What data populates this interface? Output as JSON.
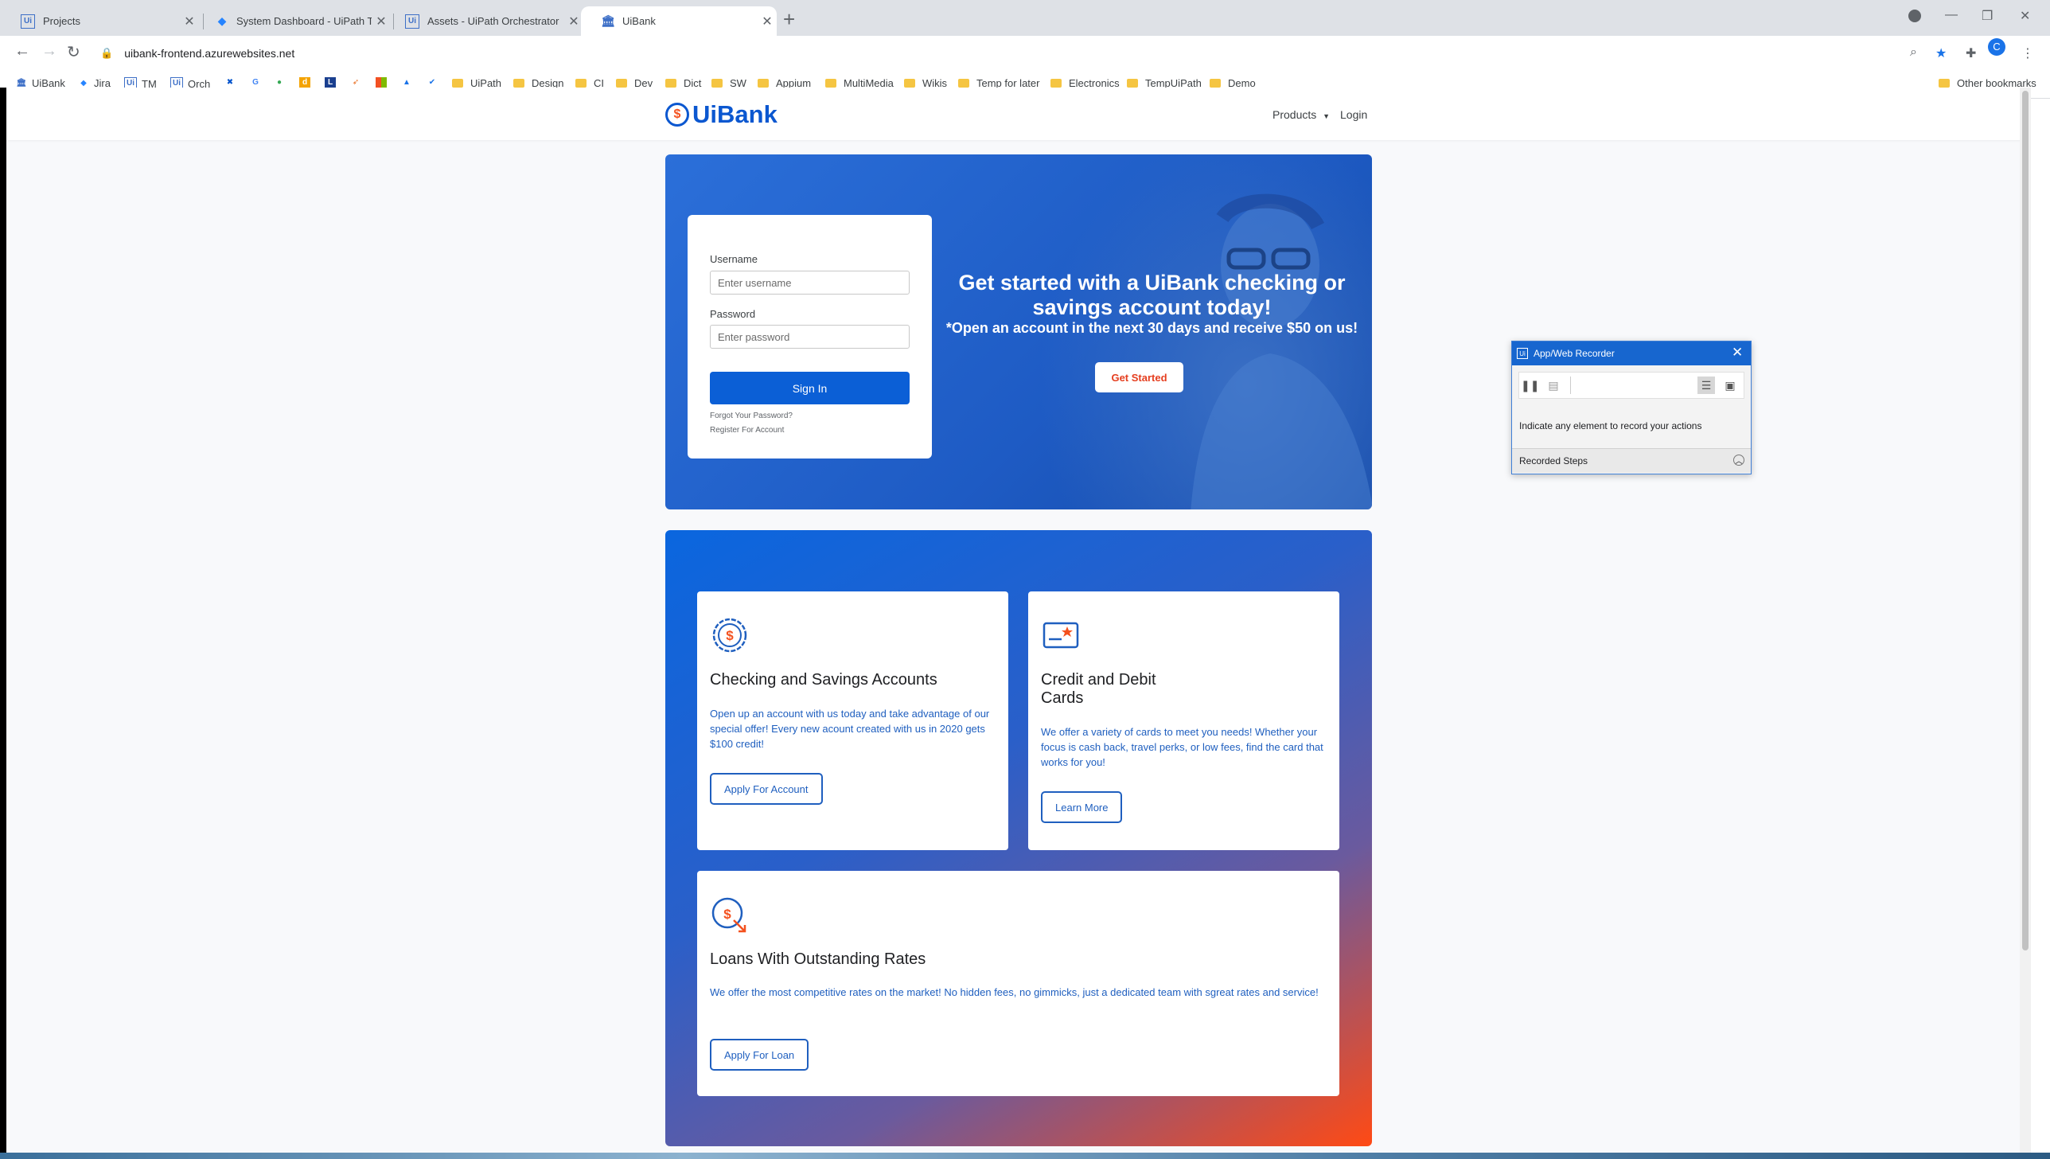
{
  "browser": {
    "tabs": [
      {
        "title": "Projects",
        "favicon": "uipath-icon"
      },
      {
        "title": "System Dashboard - UiPath Test:",
        "favicon": "jira-icon"
      },
      {
        "title": "Assets - UiPath Orchestrator",
        "favicon": "uipath-icon"
      },
      {
        "title": "UiBank",
        "favicon": "bank-icon",
        "active": true
      }
    ],
    "url": "uibank-frontend.azurewebsites.net",
    "profile_initial": "C",
    "bookmarks": [
      "UiBank",
      "Jira",
      "TM",
      "Orch",
      "UiPath",
      "Design",
      "CI",
      "Dev",
      "Dict",
      "SW",
      "Appium",
      "MultiMedia",
      "Wikis",
      "Temp for later",
      "Electronics",
      "TempUiPath",
      "Demo"
    ],
    "other_bookmarks": "Other bookmarks"
  },
  "site": {
    "logo_text": "UiBank",
    "logo_symbol": "$",
    "nav": {
      "products": "Products",
      "login": "Login"
    }
  },
  "login_form": {
    "username_label": "Username",
    "username_placeholder": "Enter username",
    "password_label": "Password",
    "password_placeholder": "Enter password",
    "signin_label": "Sign In",
    "forgot_password": "Forgot Your Password?",
    "register": "Register For Account"
  },
  "hero": {
    "title": "Get started with a UiBank checking or savings account today!",
    "subtitle": "*Open an account in the next 30 days and receive $50 on us!",
    "cta": "Get Started"
  },
  "features": [
    {
      "title": "Checking and Savings Accounts",
      "text": "Open up an account with us today and take advantage of our special offer! Every new acount created with us in 2020 gets $100 credit!",
      "button": "Apply For Account",
      "icon": "dollar-badge-icon"
    },
    {
      "title": "Credit and Debit Cards",
      "text": "We offer a variety of cards to meet you needs! Whether your focus is cash back, travel perks, or low fees, find the card that works for you!",
      "button": "Learn More",
      "icon": "credit-card-icon"
    },
    {
      "title": "Loans With Outstanding Rates",
      "text": "We offer the most competitive rates on the market! No hidden fees, no gimmicks, just a dedicated team with sgreat rates and service!",
      "button": "Apply For Loan",
      "icon": "loan-rate-icon"
    }
  ],
  "recorder": {
    "title": "App/Web Recorder",
    "message": "Indicate any element to record your actions",
    "recorded_steps": "Recorded Steps"
  },
  "colors": {
    "brand_blue": "#0b57d0",
    "accent_orange": "#f4511e",
    "recorder_title": "#1766cf"
  }
}
